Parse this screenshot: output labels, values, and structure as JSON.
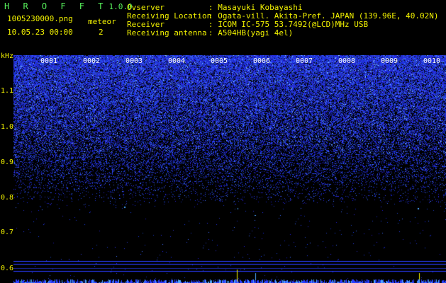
{
  "header": {
    "app_name": "H R O F F T",
    "version": "1.0.0",
    "filename": "1005230000.png",
    "datetime": "10.05.23 00:00",
    "meteor_label": "meteor",
    "meteor_count": "2"
  },
  "info": {
    "labels": [
      "Ovserver",
      "Receiving Location",
      "Receiver",
      "Receiving antenna"
    ],
    "values": [
      ": Masayuki Kobayashi",
      ": Ogata-vill. Akita-Pref. JAPAN (139.96E, 40.02N)",
      ": ICOM IC-575 53.7492(@LCD)MHz USB",
      ": A504HB(yagi 4el)"
    ]
  },
  "axis": {
    "unit": "kHz",
    "ticks": [
      "1.1",
      "1.0",
      "0.9",
      "0.8",
      "0.7",
      "0.6"
    ]
  },
  "columns": [
    "0001",
    "0002",
    "0003",
    "0004",
    "0005",
    "0006",
    "0007",
    "0008",
    "0009",
    "0010"
  ],
  "colors": {
    "yellow": "#f3f300",
    "green": "#58f25c",
    "noise": "#2a3cff",
    "background": "#000000"
  }
}
